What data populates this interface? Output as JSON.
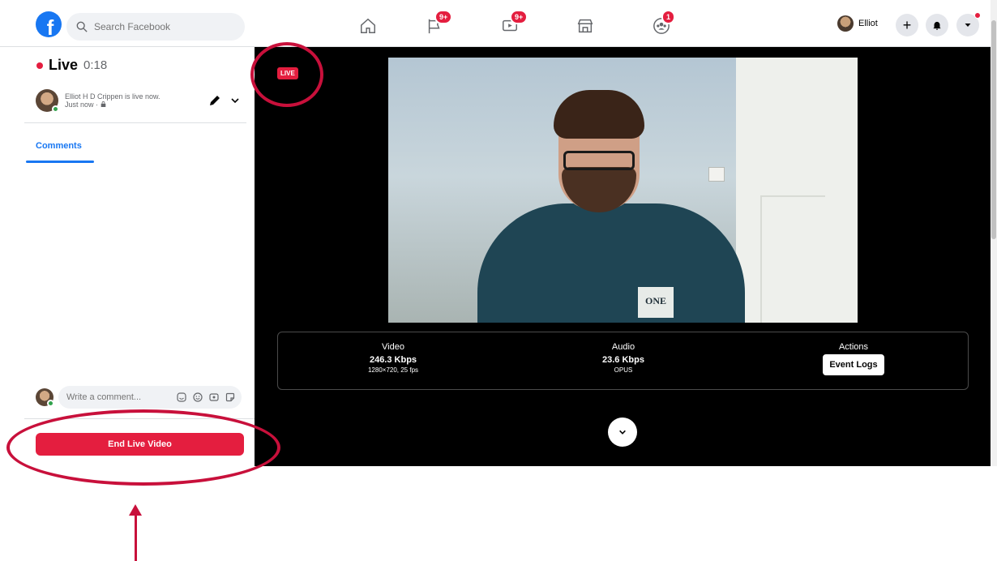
{
  "topbar": {
    "logo": "f",
    "search_placeholder": "Search Facebook",
    "nav": [
      {
        "icon": "home-icon",
        "badge": ""
      },
      {
        "icon": "flag-icon",
        "badge": "9+"
      },
      {
        "icon": "watch-icon",
        "badge": "9+"
      },
      {
        "icon": "marketplace-icon",
        "badge": ""
      },
      {
        "icon": "groups-icon",
        "badge": "1"
      }
    ],
    "profile_name": "Elliot",
    "create_label": "+"
  },
  "left_panel": {
    "live_label": "Live",
    "elapsed": "0:18",
    "host_status": "Elliot H D Crippen is live now.",
    "host_time": "Just now ·",
    "comments_tab": "Comments",
    "comment_placeholder": "Write a comment...",
    "end_button": "End Live Video"
  },
  "stage": {
    "live_badge": "LIVE",
    "video": {
      "label": "Video",
      "bitrate": "246.3 Kbps",
      "detail": "1280×720, 25 fps"
    },
    "audio": {
      "label": "Audio",
      "bitrate": "23.6 Kbps",
      "detail": "OPUS"
    },
    "actions": {
      "label": "Actions",
      "button": "Event Logs"
    },
    "shirt_logo": "ONE"
  },
  "colors": {
    "brand": "#1877f2",
    "live_red": "#e41e3f",
    "annotation": "#c8103b"
  }
}
